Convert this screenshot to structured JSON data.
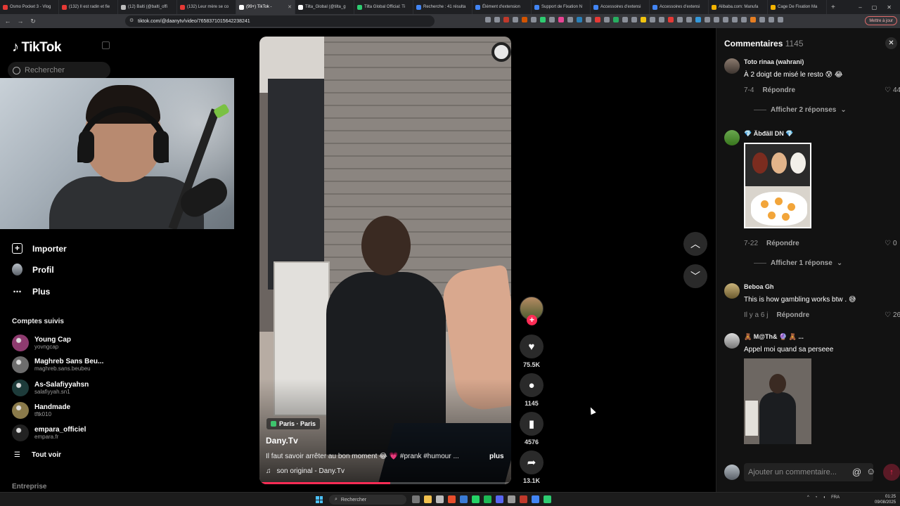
{
  "browser": {
    "tabs": [
      {
        "title": "Osmo Pocket 3 - Vlog",
        "color": "#e53935",
        "active": false
      },
      {
        "title": "(132) Il est radin et fie",
        "color": "#e53935",
        "active": false
      },
      {
        "title": "(12) Balti (@balti_offi",
        "color": "#bbbbbb",
        "active": false
      },
      {
        "title": "(132) Leur mère se co",
        "color": "#e53935",
        "active": false
      },
      {
        "title": "(99+) TikTok -",
        "color": "#ffffff",
        "active": true
      },
      {
        "title": "Tilta_Global (@tilta_g",
        "color": "#ffffff",
        "active": false
      },
      {
        "title": "Tilta Global Official: Ti",
        "color": "#2ecc71",
        "active": false
      },
      {
        "title": "Recherche : 41 résulta",
        "color": "#4285f4",
        "active": false
      },
      {
        "title": "Élément d'extension",
        "color": "#4285f4",
        "active": false
      },
      {
        "title": "Support de Fixation N",
        "color": "#4285f4",
        "active": false
      },
      {
        "title": "Accessoires d'extensi",
        "color": "#4285f4",
        "active": false
      },
      {
        "title": "Accessoires d'extensi",
        "color": "#4285f4",
        "active": false
      },
      {
        "title": "Alibaba.com: Manufa",
        "color": "#f5b400",
        "active": false
      },
      {
        "title": "Cage De Fixation Ma",
        "color": "#f5b400",
        "active": false
      }
    ],
    "new_tab": "+",
    "url": "tiktok.com/@daanytv/video/7658371015642238241",
    "update_button": "Mettre à jour"
  },
  "sidebar": {
    "logo": "TikTok",
    "search_placeholder": "Rechercher",
    "menu": [
      {
        "label": "Importer",
        "icon": "upload-icon"
      },
      {
        "label": "Profil",
        "icon": "profile-icon"
      },
      {
        "label": "Plus",
        "icon": "more-icon"
      }
    ],
    "following_title": "Comptes suivis",
    "following": [
      {
        "name": "Young Cap",
        "handle": "yovngcap",
        "color": "#8e3b6f"
      },
      {
        "name": "Maghreb Sans Beu...",
        "handle": "maghreb.sans.beubeu",
        "color": "#6d6d6d"
      },
      {
        "name": "As-Salafiyyahsn",
        "handle": "salafiyyah.sn1",
        "color": "#1d3b3a"
      },
      {
        "name": "Handmade",
        "handle": "tftk010",
        "color": "#8a7a4a"
      },
      {
        "name": "empara_officiel",
        "handle": "empara.fr",
        "color": "#222222"
      }
    ],
    "see_all": "Tout voir",
    "company": "Entreprise"
  },
  "video": {
    "location": "Paris · Paris",
    "author": "Dany.Tv",
    "caption": "Il faut savoir arrêter au bon moment 😂 💗 #prank #humour ...",
    "more": "plus",
    "sound": "son original - Dany.Tv",
    "progress": 0.52
  },
  "actions": {
    "likes": "75.5K",
    "comments": "1145",
    "saves": "4576",
    "shares": "13.1K"
  },
  "comments_panel": {
    "title": "Commentaires",
    "count": "1145",
    "input_placeholder": "Ajouter un commentaire...",
    "items": [
      {
        "user": "Toto rinaa (wahrani)",
        "text": "À 2 doigt de misé le resto 😰 😂",
        "date": "7-4",
        "reply": "Répondre",
        "likes": "442",
        "thread": "Afficher 2 réponses"
      },
      {
        "user": "💎 Äbđãll DN 💎",
        "text": "",
        "date": "7-22",
        "reply": "Répondre",
        "likes": "0",
        "thread": "Afficher 1 réponse"
      },
      {
        "user": "Beboa Gh",
        "text": "This is how gambling works btw . 😅",
        "date": "Il y a 6 j",
        "reply": "Répondre",
        "likes": "26",
        "thread": ""
      },
      {
        "user": "🧸 M@Th& 🔮 🧸 ...",
        "text": "Appel moi quand sa perseee",
        "date": "",
        "reply": "",
        "likes": "",
        "thread": ""
      }
    ]
  },
  "taskbar": {
    "search": "Rechercher",
    "lang": "FRA",
    "time": "01:25",
    "date": "09/08/2025"
  }
}
